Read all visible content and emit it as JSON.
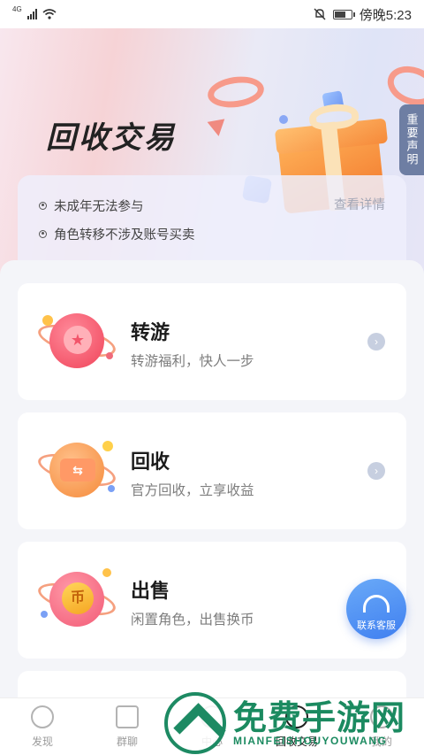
{
  "status_bar": {
    "network": "4G",
    "time": "傍晚5:23"
  },
  "hero": {
    "title": "回收交易",
    "notice_tab": "重要声明"
  },
  "rules": {
    "items": [
      "未成年无法参与",
      "角色转移不涉及账号买卖"
    ],
    "details_link": "查看详情"
  },
  "cards": [
    {
      "title": "转游",
      "desc": "转游福利，快人一步",
      "icon": "star-planet-icon"
    },
    {
      "title": "回收",
      "desc": "官方回收，立享收益",
      "icon": "ticket-planet-icon"
    },
    {
      "title": "出售",
      "desc": "闲置角色，出售换币",
      "icon": "coin-planet-icon",
      "emblem": "币"
    }
  ],
  "service": {
    "label": "联系客服"
  },
  "tabbar": {
    "items": [
      {
        "label": "发现",
        "icon": "compass-icon"
      },
      {
        "label": "群聊",
        "icon": "chat-icon"
      },
      {
        "label": "中心",
        "icon": "center-icon"
      },
      {
        "label": "回收交易",
        "icon": "recycle-icon",
        "active": true
      },
      {
        "label": "我的",
        "icon": "profile-icon"
      }
    ]
  },
  "watermark": {
    "title": "免费手游网",
    "subtitle": "MIANFEISHOUYOUWANG"
  },
  "colors": {
    "accent_blue": "#3f7ff0",
    "watermark_green": "#1b8a60",
    "notice_tab": "#6e7ea3"
  }
}
